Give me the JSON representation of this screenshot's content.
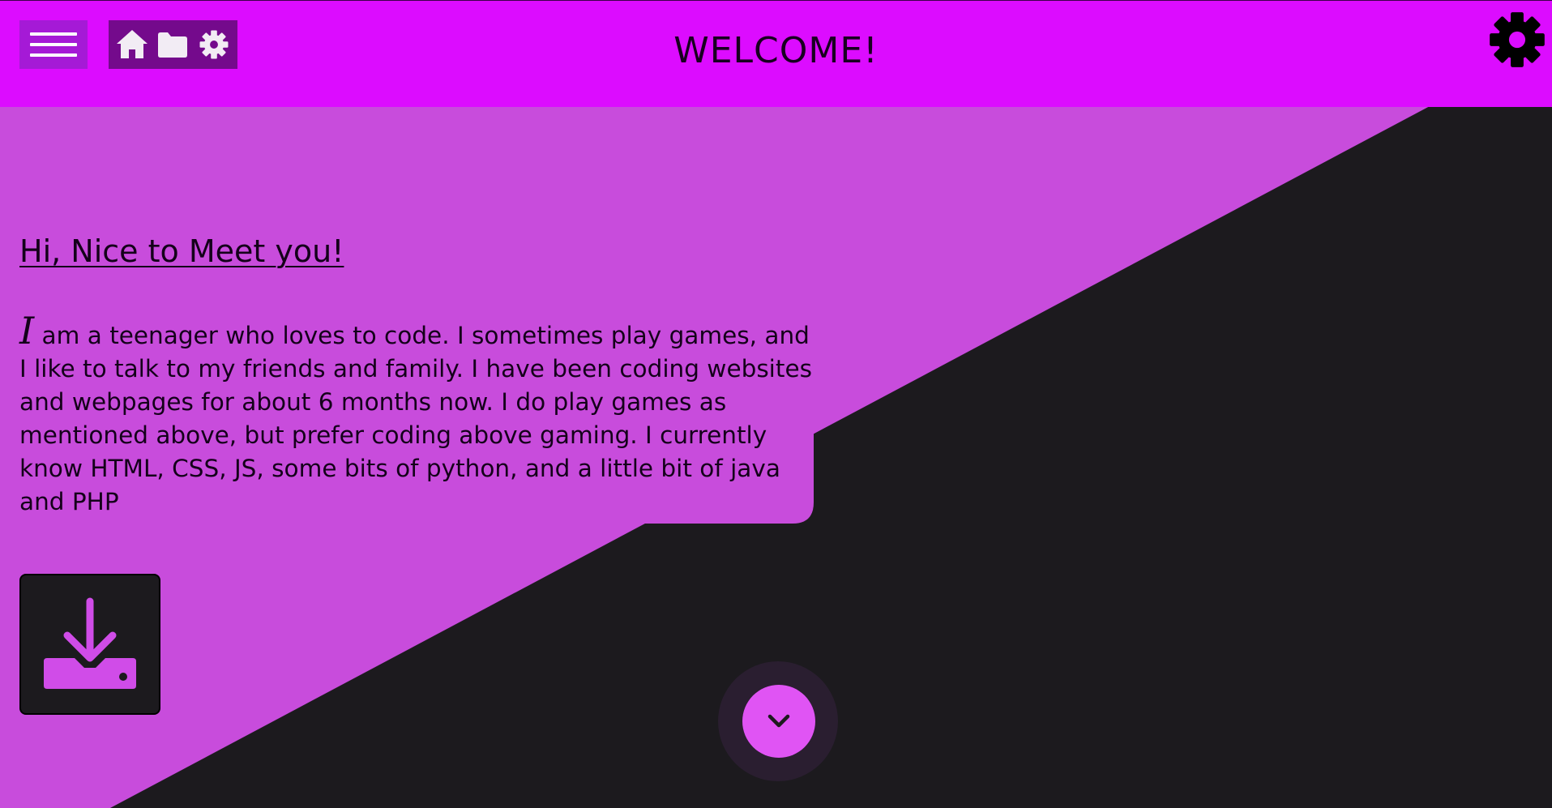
{
  "colors": {
    "header_bg": "#dc0cff",
    "content_bg": "#c84cdc",
    "dark_bg": "#1c1a1e",
    "menu_button_bg": "#a51ad6",
    "quick_nav_bg": "#740a8c",
    "accent": "#e054f4",
    "text": "#14001a"
  },
  "header": {
    "title": "WELCOME!",
    "menu_icon": "hamburger-menu-icon",
    "quick_nav": [
      {
        "icon": "home-icon"
      },
      {
        "icon": "folder-icon"
      },
      {
        "icon": "gear-icon"
      }
    ],
    "settings_icon": "gear-icon"
  },
  "intro": {
    "heading": "Hi, Nice to Meet you!",
    "bio_initial": "I",
    "bio_rest": " am a teenager who loves to code. I sometimes play games, and I like to talk to my friends and family. I have been coding websites and webpages for about 6 months now. I do play games as mentioned above, but prefer coding above gaming. I currently know HTML, CSS, JS, some bits of python, and a little bit of java and PHP"
  },
  "actions": {
    "download_icon": "download-icon",
    "scroll_down_icon": "chevron-down-icon"
  }
}
